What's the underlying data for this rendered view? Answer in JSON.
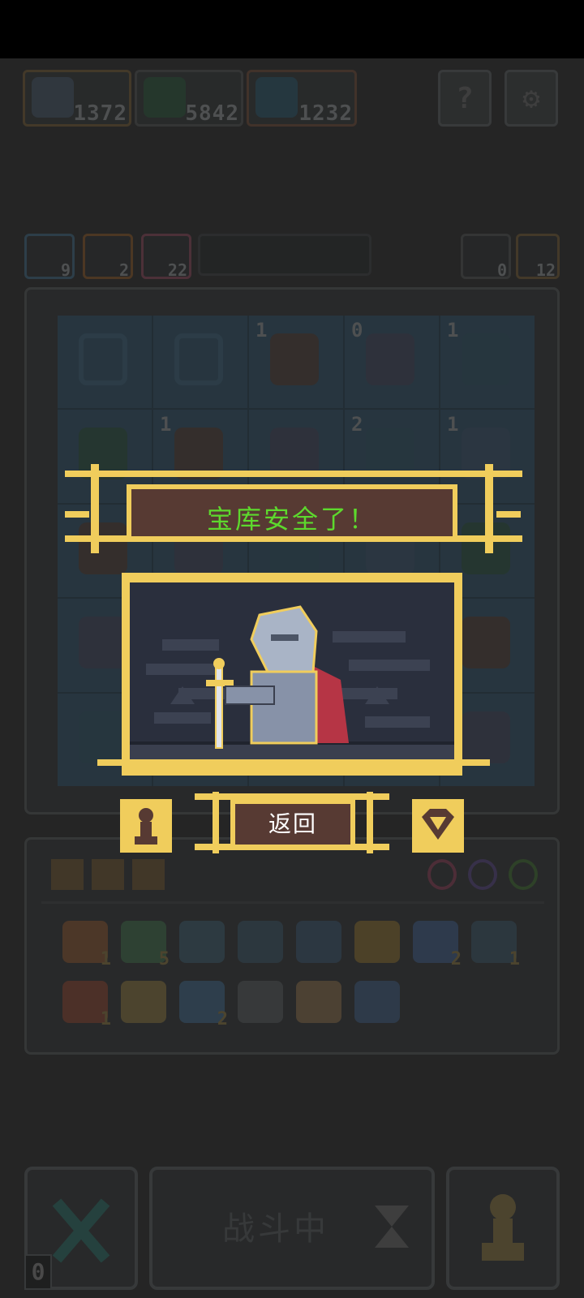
{
  "resources": [
    {
      "name": "gargoyle-resource",
      "value": "1372"
    },
    {
      "name": "dragon-resource",
      "value": "5842"
    },
    {
      "name": "ghost-resource",
      "value": "1232"
    }
  ],
  "top_buttons": {
    "help": "?",
    "settings": "⚙"
  },
  "stats": [
    {
      "name": "blue-stat",
      "value": "9"
    },
    {
      "name": "orange-stat",
      "value": "2"
    },
    {
      "name": "pink-stat",
      "value": "22"
    }
  ],
  "right_counters": [
    {
      "name": "reroll-counter",
      "value": "0"
    },
    {
      "name": "key-counter",
      "value": "12"
    }
  ],
  "board_levels": [
    [
      "",
      "",
      "1",
      "0",
      "1"
    ],
    [
      "",
      "1",
      "",
      "2",
      "1"
    ],
    [
      "",
      "",
      "",
      "",
      ""
    ],
    [
      "",
      "",
      "",
      "",
      ""
    ],
    [
      "",
      "",
      "",
      "",
      ""
    ]
  ],
  "inventory": {
    "row1_counts": [
      "1",
      "5",
      "",
      "",
      "",
      "",
      "2",
      "1"
    ],
    "row2_counts": [
      "1",
      "",
      "2",
      "",
      "",
      "",
      ""
    ]
  },
  "popup": {
    "title": "宝库安全了！",
    "back_label": "返回"
  },
  "bottom": {
    "fight_label": "战斗中",
    "zero_badge": "0"
  },
  "colors": {
    "gold": "#f0cd5c",
    "panel": "#573a33",
    "title_text": "#5dd92d"
  }
}
